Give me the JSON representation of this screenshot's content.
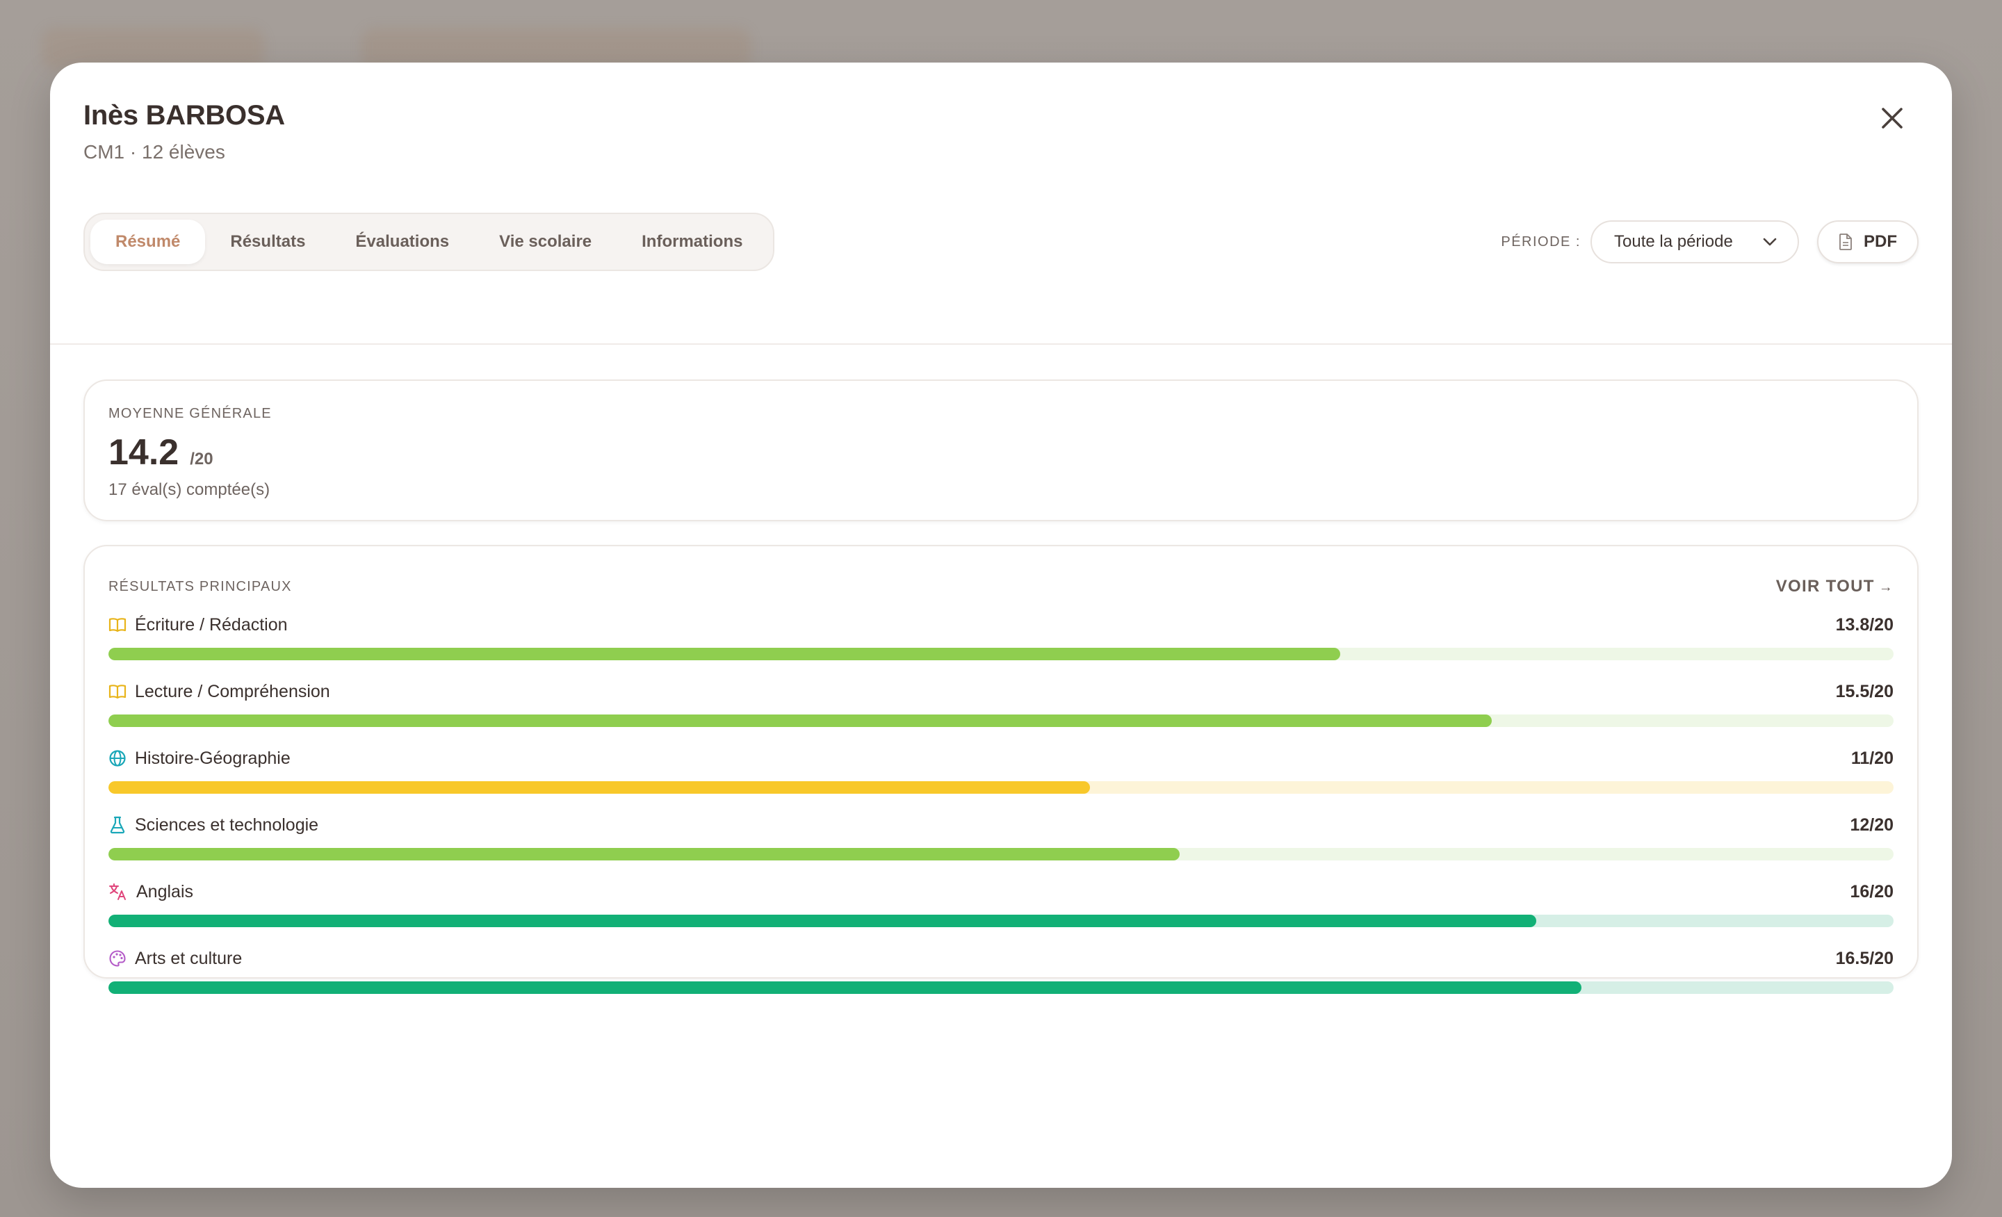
{
  "student": {
    "name": "Inès BARBOSA",
    "subtitle": "CM1 · 12 élèves"
  },
  "tabs": [
    {
      "label": "Résumé",
      "active": true
    },
    {
      "label": "Résultats",
      "active": false
    },
    {
      "label": "Évaluations",
      "active": false
    },
    {
      "label": "Vie scolaire",
      "active": false
    },
    {
      "label": "Informations",
      "active": false
    }
  ],
  "period": {
    "label": "PÉRIODE :",
    "selected": "Toute la période"
  },
  "pdf_label": "PDF",
  "average": {
    "label": "MOYENNE GÉNÉRALE",
    "value": "14.2",
    "scale": "/20",
    "count": "17 éval(s) comptée(s)"
  },
  "results": {
    "label": "RÉSULTATS PRINCIPAUX",
    "see_all": "VOIR TOUT",
    "see_all_arrow": "→",
    "subjects": [
      {
        "name": "Écriture / Rédaction",
        "grade": "13.8/20",
        "score": 13.8,
        "icon": "book-icon",
        "icon_color": "#e8b41a",
        "bar_color": "#8fce4f",
        "track_color": "#eef7e6"
      },
      {
        "name": "Lecture / Compréhension",
        "grade": "15.5/20",
        "score": 15.5,
        "icon": "book-icon",
        "icon_color": "#e8b41a",
        "bar_color": "#8fce4f",
        "track_color": "#eef7e6"
      },
      {
        "name": "Histoire-Géographie",
        "grade": "11/20",
        "score": 11,
        "icon": "globe-icon",
        "icon_color": "#1aa7b8",
        "bar_color": "#f8c82a",
        "track_color": "#fdf4d8"
      },
      {
        "name": "Sciences et technologie",
        "grade": "12/20",
        "score": 12,
        "icon": "flask-icon",
        "icon_color": "#1aa7b8",
        "bar_color": "#8fce4f",
        "track_color": "#eef7e6"
      },
      {
        "name": "Anglais",
        "grade": "16/20",
        "score": 16,
        "icon": "translate-icon",
        "icon_color": "#e0457b",
        "bar_color": "#12b076",
        "track_color": "#d6efe6"
      },
      {
        "name": "Arts et culture",
        "grade": "16.5/20",
        "score": 16.5,
        "icon": "palette-icon",
        "icon_color": "#b45cc8",
        "bar_color": "#12b076",
        "track_color": "#d6efe6"
      }
    ]
  }
}
